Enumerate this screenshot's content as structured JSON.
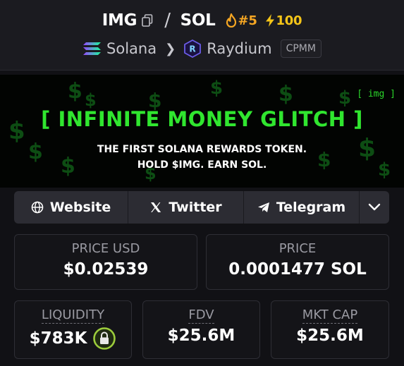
{
  "header": {
    "base_symbol": "IMG",
    "separator": "/",
    "quote_symbol": "SOL",
    "rank": "#5",
    "boosts": "100",
    "chain": "Solana",
    "dex": "Raydium",
    "pool_type": "CPMM",
    "colors": {
      "rank": "#f5a623",
      "boost": "#f5c518"
    }
  },
  "banner": {
    "tag": "[ img ]",
    "title": "[ INFINITE MONEY GLITCH ]",
    "line1": "THE FIRST SOLANA REWARDS TOKEN.",
    "line2": "HOLD $IMG. EARN SOL.",
    "colors": {
      "title": "#30e62f",
      "background": "#020402"
    }
  },
  "links": [
    {
      "label": "Website",
      "icon": "globe-icon"
    },
    {
      "label": "Twitter",
      "icon": "x-logo-icon"
    },
    {
      "label": "Telegram",
      "icon": "telegram-icon"
    }
  ],
  "stats": {
    "price_usd": {
      "label": "PRICE USD",
      "value": "$0.02539"
    },
    "price_native": {
      "label": "PRICE",
      "value": "0.0001477 SOL"
    },
    "liquidity": {
      "label": "LIQUIDITY",
      "value": "$783K"
    },
    "fdv": {
      "label": "FDV",
      "value": "$25.6M"
    },
    "mkt_cap": {
      "label": "MKT CAP",
      "value": "$25.6M"
    }
  }
}
